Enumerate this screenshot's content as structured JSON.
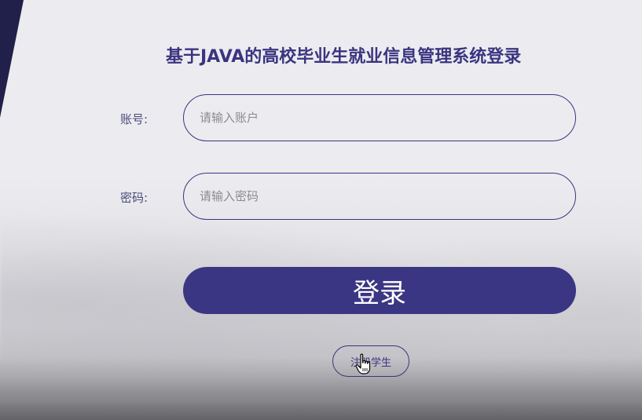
{
  "header": {
    "title": "基于JAVA的高校毕业生就业信息管理系统登录"
  },
  "form": {
    "username_label": "账号:",
    "username_placeholder": "请输入账户",
    "username_value": "",
    "password_label": "密码:",
    "password_placeholder": "请输入密码",
    "password_value": ""
  },
  "actions": {
    "login_label": "登录",
    "register_label": "注册学生"
  },
  "colors": {
    "accent": "#3b3683",
    "text_primary": "#3b3480",
    "background": "#ececf0"
  },
  "icons": {
    "cursor": "hand-pointer-icon"
  }
}
